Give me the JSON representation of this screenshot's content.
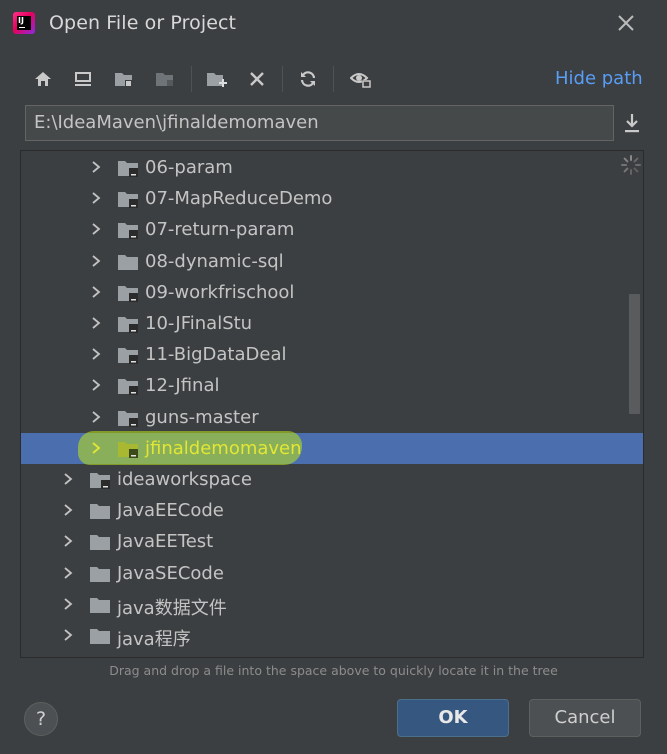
{
  "window": {
    "title": "Open File or Project",
    "icon": "intellij-idea-icon"
  },
  "toolbar": {
    "hide_path_label": "Hide path",
    "icons": [
      "home-icon",
      "desktop-icon",
      "project-icon",
      "module-icon",
      "new-folder-icon",
      "delete-icon",
      "refresh-icon",
      "show-hidden-icon"
    ]
  },
  "path": {
    "value": "E:\\IdeaMaven\\jfinaldemomaven"
  },
  "tree": {
    "items": [
      {
        "label": "06-param",
        "level": 1,
        "type": "project"
      },
      {
        "label": "07-MapReduceDemo",
        "level": 1,
        "type": "project"
      },
      {
        "label": "07-return-param",
        "level": 1,
        "type": "project"
      },
      {
        "label": "08-dynamic-sql",
        "level": 1,
        "type": "plain"
      },
      {
        "label": "09-workfrischool",
        "level": 1,
        "type": "project"
      },
      {
        "label": "10-JFinalStu",
        "level": 1,
        "type": "project"
      },
      {
        "label": "11-BigDataDeal",
        "level": 1,
        "type": "project"
      },
      {
        "label": "12-Jfinal",
        "level": 1,
        "type": "project"
      },
      {
        "label": "guns-master",
        "level": 1,
        "type": "project"
      },
      {
        "label": "jfinaldemomaven",
        "level": 1,
        "type": "project",
        "selected": true
      },
      {
        "label": "ideaworkspace",
        "level": 0,
        "type": "project"
      },
      {
        "label": "JavaEECode",
        "level": 0,
        "type": "plain"
      },
      {
        "label": "JavaEETest",
        "level": 0,
        "type": "plain"
      },
      {
        "label": "JavaSECode",
        "level": 0,
        "type": "plain"
      },
      {
        "label": "java数据文件",
        "level": 0,
        "type": "plain"
      },
      {
        "label": "java程序",
        "level": 0,
        "type": "plain"
      }
    ]
  },
  "hint": "Drag and drop a file into the space above to quickly locate it in the tree",
  "buttons": {
    "help": "?",
    "ok": "OK",
    "cancel": "Cancel"
  },
  "colors": {
    "background": "#3c3f41",
    "selection": "#4b6eaf",
    "link": "#589df6",
    "highlight": "#c8e614"
  }
}
